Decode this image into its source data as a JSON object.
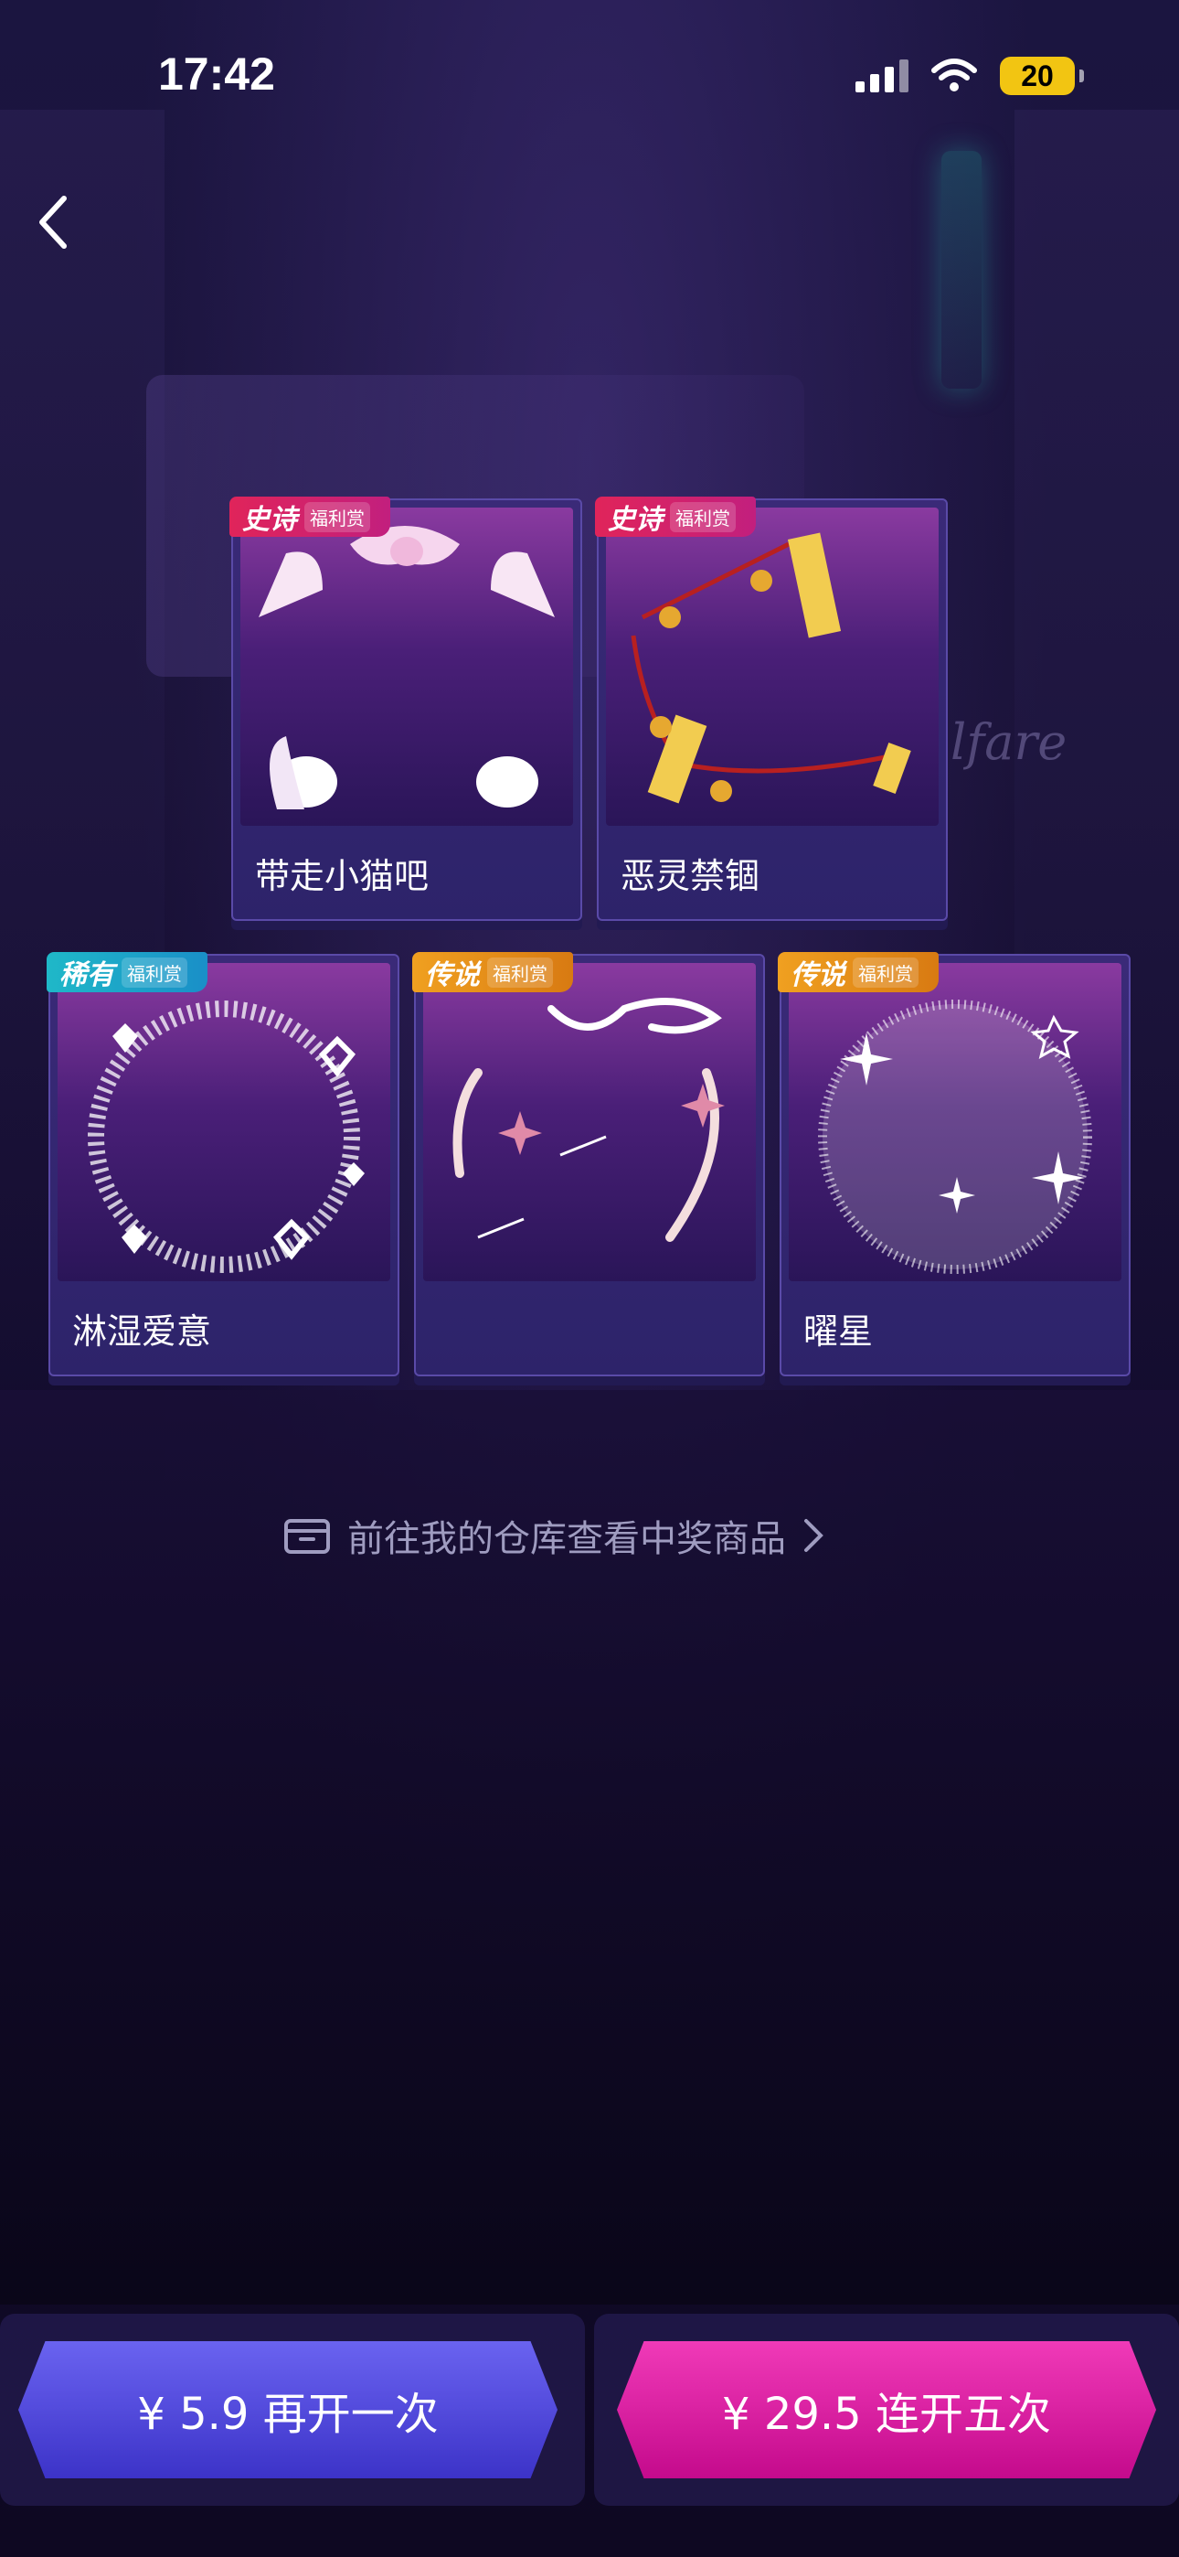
{
  "status_bar": {
    "time": "17:42",
    "battery": "20"
  },
  "background": {
    "script_text": "lfare"
  },
  "prizes": [
    {
      "name": "带走小猫吧",
      "badge": "史诗",
      "badge_sub": "福利赏",
      "rarity": "epic"
    },
    {
      "name": "恶灵禁锢",
      "badge": "史诗",
      "badge_sub": "福利赏",
      "rarity": "epic"
    },
    {
      "name": "淋湿爱意",
      "badge": "稀有",
      "badge_sub": "福利赏",
      "rarity": "rare"
    },
    {
      "name": "",
      "badge": "传说",
      "badge_sub": "福利赏",
      "rarity": "legend"
    },
    {
      "name": "曜星",
      "badge": "传说",
      "badge_sub": "福利赏",
      "rarity": "legend"
    }
  ],
  "warehouse_link": "前往我的仓库查看中奖商品",
  "buttons": {
    "single": "¥ 5.9 再开一次",
    "five": "¥ 29.5 连开五次"
  },
  "colors": {
    "epic": "#e0245a",
    "rare": "#1fb8c8",
    "legend": "#f0a020",
    "primary": "#4a42d8",
    "accent": "#e0209e"
  },
  "icons": [
    "back-arrow-icon",
    "signal-icon",
    "wifi-icon",
    "battery-icon",
    "box-icon",
    "chevron-right-icon"
  ]
}
